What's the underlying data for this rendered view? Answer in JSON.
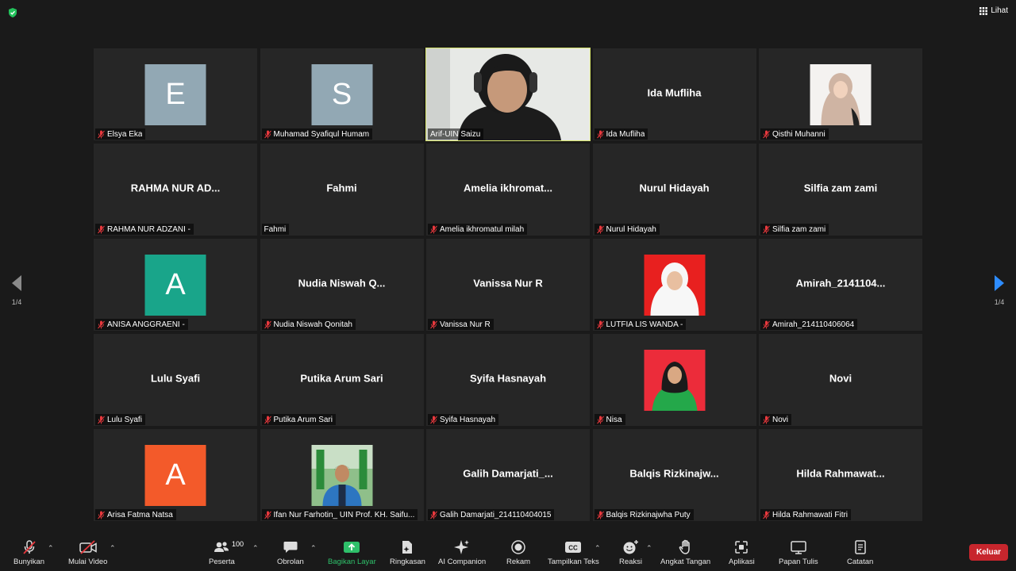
{
  "top": {
    "view_label": "Lihat"
  },
  "pager": {
    "left_label": "1/4",
    "right_label": "1/4"
  },
  "tiles": [
    {
      "name": "Elsya Eka",
      "display": "letter",
      "letter": "E",
      "color": "#92a8b4"
    },
    {
      "name": "Muhamad Syafiqul Humam",
      "display": "letter",
      "letter": "S",
      "color": "#92a8b4"
    },
    {
      "name": "Arif-UIN Saizu",
      "display": "video"
    },
    {
      "name": "Ida Mufliha",
      "display": "name",
      "center": "Ida Mufliha"
    },
    {
      "name": "Qisthi Muhanni",
      "display": "photo",
      "photo": "hijab-beige"
    },
    {
      "name": "RAHMA NUR ADZANI -",
      "display": "name",
      "center": "RAHMA NUR AD..."
    },
    {
      "name": "Fahmi",
      "display": "name",
      "center": "Fahmi"
    },
    {
      "name": "Amelia ikhromatul milah",
      "display": "name",
      "center": "Amelia ikhromat..."
    },
    {
      "name": "Nurul Hidayah",
      "display": "name",
      "center": "Nurul Hidayah"
    },
    {
      "name": "Silfia zam zami",
      "display": "name",
      "center": "Silfia zam zami"
    },
    {
      "name": "ANISA ANGGRAENI -",
      "display": "letter",
      "letter": "A",
      "color": "#19a58a"
    },
    {
      "name": "Nudia Niswah Qonitah",
      "display": "name",
      "center": "Nudia Niswah Q..."
    },
    {
      "name": "Vanissa Nur R",
      "display": "name",
      "center": "Vanissa Nur R"
    },
    {
      "name": "LUTFIA LIS WANDA -",
      "display": "photo",
      "photo": "hijab-white-red"
    },
    {
      "name": "Amirah_214110406064",
      "display": "name",
      "center": "Amirah_2141104..."
    },
    {
      "name": "Lulu Syafi",
      "display": "name",
      "center": "Lulu Syafi"
    },
    {
      "name": "Putika Arum Sari",
      "display": "name",
      "center": "Putika Arum Sari"
    },
    {
      "name": "Syifa Hasnayah",
      "display": "name",
      "center": "Syifa Hasnayah"
    },
    {
      "name": "Nisa",
      "display": "photo",
      "photo": "hijab-green-red"
    },
    {
      "name": "Novi",
      "display": "name",
      "center": "Novi"
    },
    {
      "name": "Arisa Fatma Natsa",
      "display": "letter",
      "letter": "A",
      "color": "#f35a2a"
    },
    {
      "name": "Ifan Nur Farhotin_ UIN Prof. KH. Saifu...",
      "display": "photo",
      "photo": "man-blue-jacket"
    },
    {
      "name": "Galih Damarjati_214110404015",
      "display": "name",
      "center": "Galih  Damarjati_..."
    },
    {
      "name": "Balqis Rizkinajwha Puty",
      "display": "name",
      "center": "Balqis  Rizkinajw..."
    },
    {
      "name": "Hilda Rahmawati Fitri",
      "display": "name",
      "center": "Hilda  Rahmawat..."
    }
  ],
  "toolbar": {
    "unmute": "Bunyikan",
    "start_video": "Mulai Video",
    "participants": "Peserta",
    "participant_count": "100",
    "chat": "Obrolan",
    "share": "Bagikan Layar",
    "summary": "Ringkasan",
    "ai": "AI Companion",
    "record": "Rekam",
    "captions": "Tampilkan Teks",
    "reactions": "Reaksi",
    "raise_hand": "Angkat Tangan",
    "apps": "Aplikasi",
    "whiteboard": "Papan Tulis",
    "notes": "Catatan",
    "leave": "Keluar"
  },
  "colors": {
    "accent_green": "#2ec06a",
    "leave_red": "#c7262d",
    "active_border": "#d6e36b",
    "tile_bg": "#262626"
  }
}
